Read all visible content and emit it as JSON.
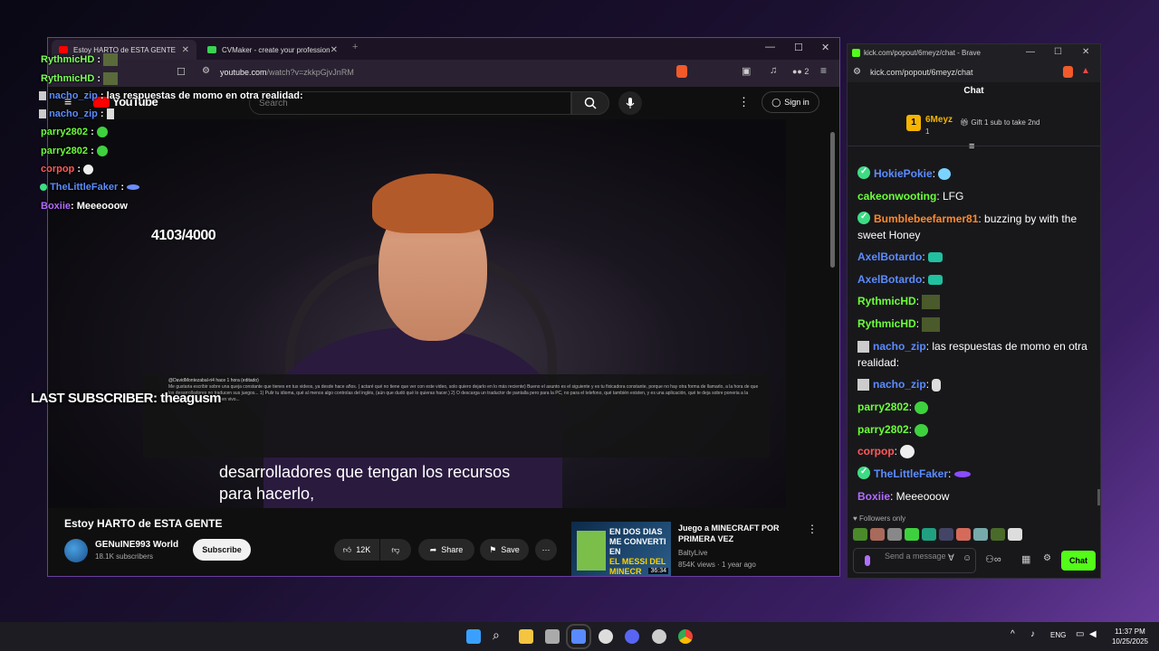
{
  "browser": {
    "tabs": [
      {
        "label": "Estoy HARTO de ESTA GENTE",
        "active": true,
        "color": "#ff0000"
      },
      {
        "label": "CVMaker - create your professional",
        "active": false,
        "color": "#39d353"
      }
    ],
    "url_main": "youtube.com",
    "url_rest": "/watch?v=zkkpGjvJnRM",
    "extensions_count": "2"
  },
  "youtube": {
    "logo": "YouTube",
    "search_placeholder": "Search",
    "sign_in": "Sign in",
    "subtitle_line1": "desarrolladores que tengan los recursos",
    "subtitle_line2": "para hacerlo,",
    "comment_author": "@DavidMontezabal-ri4  hace 1 hora (editado)",
    "comment_text": "Me gustaria escribir sobre una queja constante que tienes en tus videos, ya desde hace años. ( actaré qué no tiene que ver con este video, solo quiero dejarlo en lo más reciente) Bueno el asunto es el siguiente y es tu fixicadora constante, porque no hay otra forma de llamarlo, a la hora de que los desarrolladores no traducen sus juegos... 1) Pulir tu idioma, qué al menos algo controlas del inglés, (aún que dudó qué lo quieras hacer.) 2) O descarga un traductor de pantalla pero para la PC, no para el telefono, qué también existen, y es una aplicación, qué te deja sobre poneria a la pantalla, y te deja traducir en vivo...",
    "title": "Estoy HARTO de ESTA GENTE",
    "channel": "GENuINE993 World",
    "subscribers": "18.1K subscribers",
    "subscribe": "Subscribe",
    "likes": "12K",
    "share": "Share",
    "save": "Save",
    "recommended": {
      "thumb_l1": "EN DOS DIAS",
      "thumb_l2": "ME CONVERTI EN",
      "thumb_l3": "EL MESSI DEL",
      "thumb_l4": "MINECR",
      "duration": "36:34",
      "title": "Juego a MINECRAFT POR PRIMERA VEZ",
      "channel": "BaltyLive",
      "meta": "854K views · 1 year ago"
    }
  },
  "stream_overlay": {
    "chat": [
      {
        "user": "RythmicHD",
        "color": "#7dff5a",
        "msg": ":",
        "emote": "#5a6a3a"
      },
      {
        "user": "RythmicHD",
        "color": "#7dff5a",
        "msg": ":",
        "emote": "#5a6a3a"
      },
      {
        "user": "nacho_zip",
        "color": "#5b8cff",
        "msg": ": las respuestas de momo en otra realidad:",
        "emote": ""
      },
      {
        "user": "nacho_zip",
        "color": "#5b8cff",
        "msg": ":",
        "emote": "#dddddd"
      },
      {
        "user": "parry2802",
        "color": "#6cff3a",
        "msg": ":",
        "emote": "#3ed13e"
      },
      {
        "user": "parry2802",
        "color": "#6cff3a",
        "msg": ":",
        "emote": "#3ed13e"
      },
      {
        "user": "corpop",
        "color": "#ff5a5a",
        "msg": ":",
        "emote": "#eeeeee"
      },
      {
        "user": "TheLittleFaker",
        "color": "#5b8cff",
        "msg": ":",
        "emote": "#6c8cff"
      },
      {
        "user": "Boxiie",
        "color": "#b36bff",
        "msg": ": Meeeooow",
        "emote": ""
      }
    ],
    "counter": "4103/4000",
    "last_subscriber": "LAST SUBSCRIBER: theagusm"
  },
  "kick": {
    "window_title": "kick.com/popout/6meyz/chat - Brave",
    "url": "kick.com/popout/6meyz/chat",
    "chat_label": "Chat",
    "pinned_user": "6Meyz",
    "pinned_rank": "1",
    "pinned_count": "1",
    "gift_text": "Gift 1 sub to take 2nd",
    "messages": [
      {
        "user": "HokiePokie",
        "color": "#5b8cff",
        "verified": true,
        "text": ":"
      },
      {
        "user": "cakeonwooting",
        "color": "#6cff3a",
        "verified": false,
        "text": ": LFG"
      },
      {
        "user": "Bumblebeefarmer81",
        "color": "#ff8a2a",
        "verified": true,
        "text": ": buzzing by with the sweet Honey"
      },
      {
        "user": "AxelBotardo",
        "color": "#5b8cff",
        "verified": false,
        "text": ":"
      },
      {
        "user": "AxelBotardo",
        "color": "#5b8cff",
        "verified": false,
        "text": ":"
      },
      {
        "user": "RythmicHD",
        "color": "#6cff3a",
        "verified": false,
        "text": ":"
      },
      {
        "user": "RythmicHD",
        "color": "#6cff3a",
        "verified": false,
        "text": ":"
      },
      {
        "user": "nacho_zip",
        "color": "#5b8cff",
        "verified": false,
        "text": ": las respuestas de momo en otra realidad:"
      },
      {
        "user": "nacho_zip",
        "color": "#5b8cff",
        "verified": false,
        "text": ":"
      },
      {
        "user": "parry2802",
        "color": "#6cff3a",
        "verified": false,
        "text": ":"
      },
      {
        "user": "parry2802",
        "color": "#6cff3a",
        "verified": false,
        "text": ":"
      },
      {
        "user": "corpop",
        "color": "#ff5a5a",
        "verified": false,
        "text": ":"
      },
      {
        "user": "TheLittleFaker",
        "color": "#5b8cff",
        "verified": true,
        "text": ":"
      },
      {
        "user": "Boxiie",
        "color": "#b36bff",
        "verified": false,
        "text": ": Meeeooow"
      }
    ],
    "followers_only": "Followers only",
    "input_placeholder": "Send a message",
    "send": "Chat",
    "accent": "#53fc18"
  },
  "taskbar": {
    "lang": "ENG",
    "time": "11:37 PM",
    "date": "10/25/2025"
  }
}
